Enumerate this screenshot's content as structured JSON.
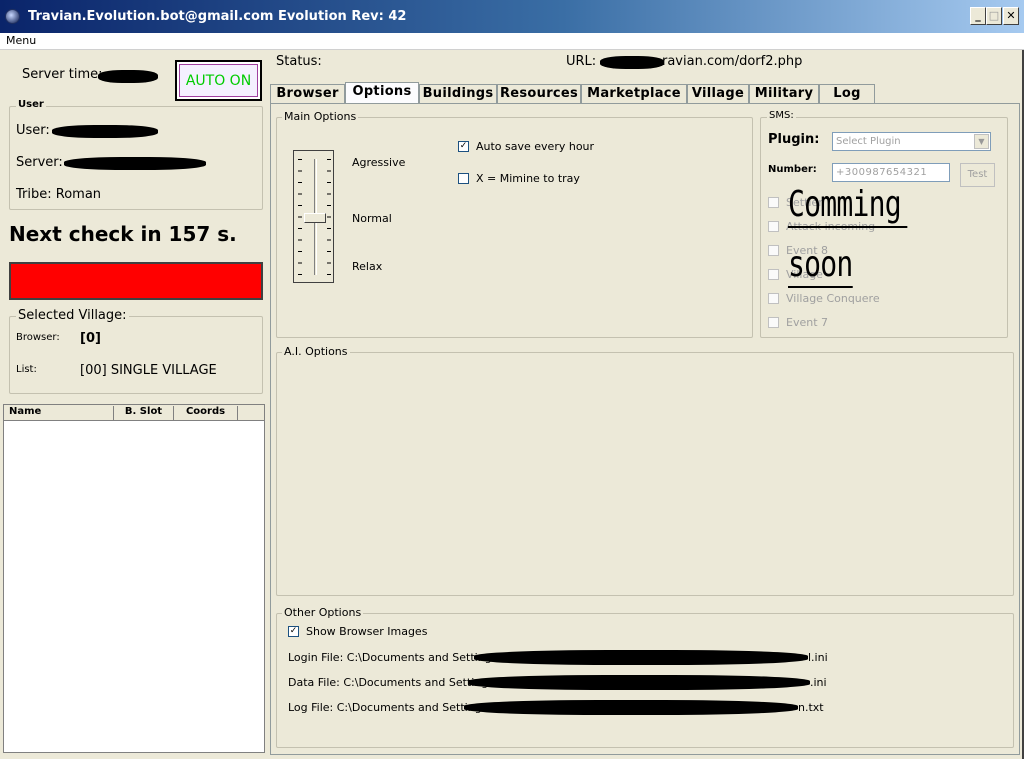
{
  "window": {
    "title": "Travian.Evolution.bot@gmail.com  Evolution Rev: 42"
  },
  "menu": {
    "label": "Menu"
  },
  "left": {
    "server_time_label": "Server time:",
    "auto_button": "AUTO ON",
    "user_group": "User",
    "user_label": "User:",
    "server_label": "Server:",
    "tribe": "Tribe: Roman",
    "next_check": "Next check in 157 s.",
    "progress_color": "#ff0000",
    "selected_village_group": "Selected Village:",
    "browser_label": "Browser:",
    "browser_value": "[0]",
    "list_label": "List:",
    "list_value": "[00] SINGLE VILLAGE",
    "table_columns": [
      "Name",
      "B. Slot",
      "Coords"
    ]
  },
  "header": {
    "status_label": "Status:",
    "url_label": "URL:",
    "url_value": "ravian.com/dorf2.php"
  },
  "tabs": [
    "Browser",
    "Options",
    "Buildings",
    "Resources",
    "Marketplace",
    "Village",
    "Military",
    "Log"
  ],
  "active_tab": "Options",
  "main_options": {
    "group": "Main Options",
    "slider_labels": [
      "Agressive",
      "Normal",
      "Relax"
    ],
    "slider_value": "Normal",
    "auto_save_label": "Auto save every hour",
    "auto_save_checked": true,
    "minimize_label": "X = Mimine to tray",
    "minimize_checked": false
  },
  "sms": {
    "group": "SMS:",
    "plugin_label": "Plugin:",
    "plugin_value": "Select Plugin",
    "number_label": "Number:",
    "number_placeholder": "+300987654321",
    "test_button": "Test",
    "events": [
      "Settler",
      "Attack incoming",
      "Event 8",
      "Village",
      "Village Conquere",
      "Event 7"
    ],
    "overlay_line1": "Comming",
    "overlay_line2": "soon"
  },
  "ai_options": {
    "group": "A.I. Options"
  },
  "other_options": {
    "group": "Other Options",
    "show_images_label": "Show Browser Images",
    "show_images_checked": true,
    "login_file_label": "Login File: C:\\Documents and Settings\\",
    "login_file_ext": "l.ini",
    "data_file_label": "Data File: C:\\Documents and Settings\\",
    "data_file_ext": ".ini",
    "log_file_label": "Log File: C:\\Documents and Settings\\",
    "log_file_ext": "n.txt"
  }
}
